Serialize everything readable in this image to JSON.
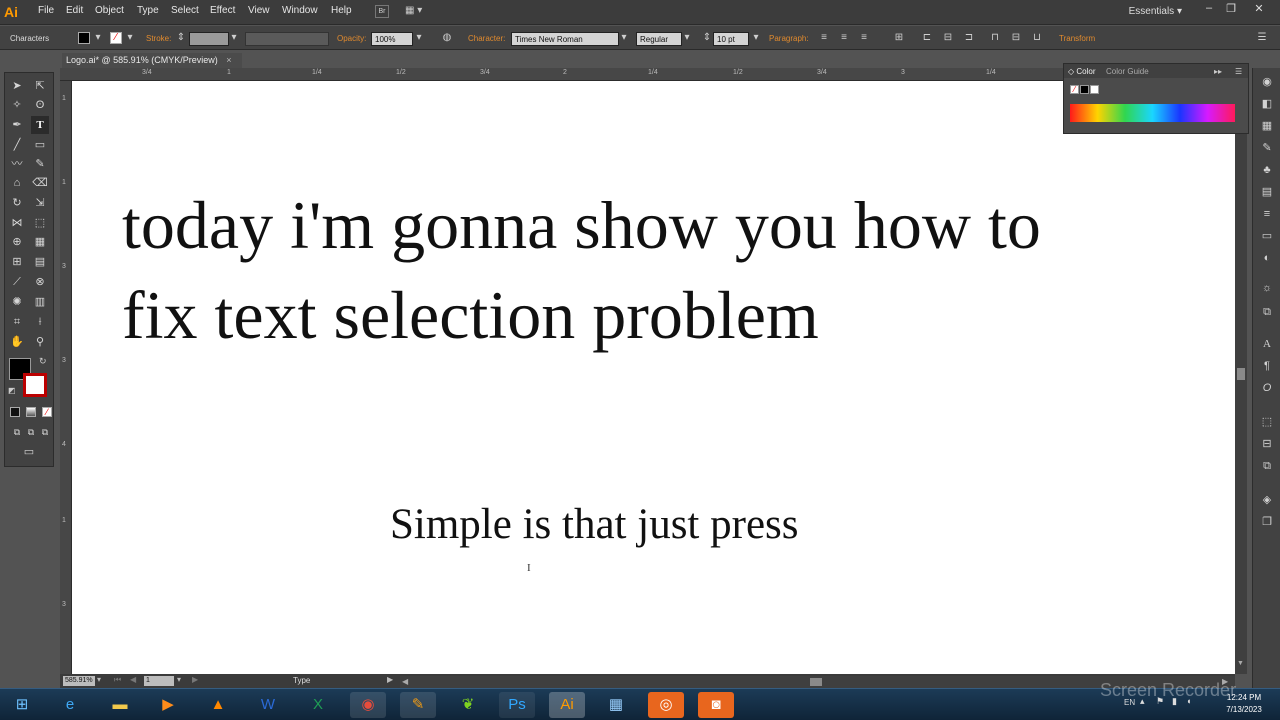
{
  "app": {
    "logo_text": "Ai",
    "menu": [
      "File",
      "Edit",
      "Object",
      "Type",
      "Select",
      "Effect",
      "View",
      "Window",
      "Help"
    ],
    "bridge_label": "Br",
    "workspace": "Essentials"
  },
  "control_bar": {
    "panel_label": "Characters",
    "stroke_label": "Stroke:",
    "opacity_label": "Opacity:",
    "opacity_value": "100%",
    "character_label": "Character:",
    "font_family": "Times New Roman",
    "font_style": "Regular",
    "font_size": "10 pt",
    "paragraph_label": "Paragraph:",
    "transform_label": "Transform"
  },
  "document": {
    "tab_title": "Logo.ai* @ 585.91% (CMYK/Preview)",
    "close_glyph": "×"
  },
  "ruler_top_ticks": [
    "3/4",
    "1",
    "1/4",
    "1/2",
    "3/4",
    "2",
    "1/4",
    "1/2",
    "3/4",
    "3",
    "1/4"
  ],
  "ruler_left_ticks": [
    "1",
    "1",
    "3",
    "3",
    "4",
    "1",
    "3"
  ],
  "canvas": {
    "headline_line1": "today i'm gonna show you how to",
    "headline_line2": "fix text selection problem",
    "subtext": "Simple is that just press"
  },
  "color_panel": {
    "tab_color": "Color",
    "tab_guide": "Color Guide"
  },
  "status_bar": {
    "zoom": "585.91%",
    "artboard": "1",
    "tool": "Type"
  },
  "taskbar": {
    "clock_time": "12:24 PM",
    "clock_date": "7/13/2023",
    "lang": "EN"
  },
  "watermark": "Screen Recorder"
}
